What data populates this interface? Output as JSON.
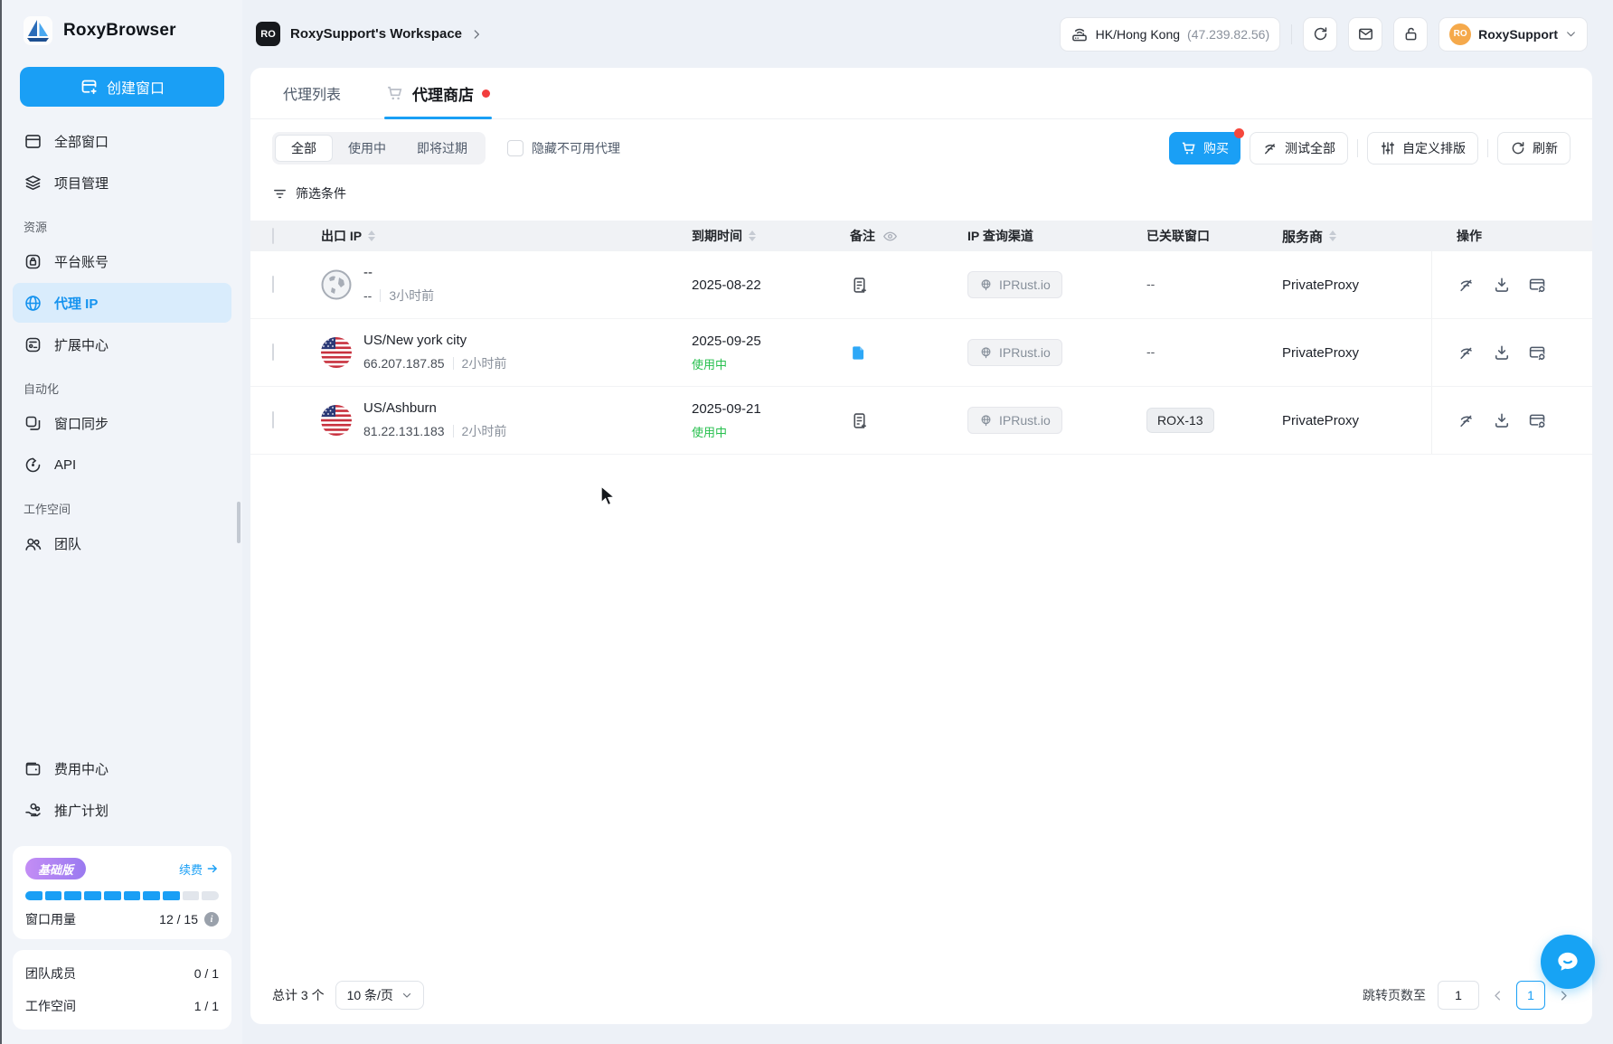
{
  "app": {
    "name": "RoxyBrowser"
  },
  "colors": {
    "accent": "#1a9ff5",
    "green": "#26bf4d",
    "red": "#f5473c",
    "badge_gradient": [
      "#c38df5",
      "#9a7af0"
    ],
    "avatar_orange": "#f5a94b"
  },
  "sidebar": {
    "create_button": "创建窗口",
    "nav": {
      "all_windows": "全部窗口",
      "projects": "项目管理",
      "platform_accounts": "平台账号",
      "proxy_ip": "代理 IP",
      "extensions": "扩展中心",
      "window_sync": "窗口同步",
      "api": "API",
      "team": "团队"
    },
    "sections": {
      "resources": "资源",
      "automation": "自动化",
      "workspace": "工作空间"
    },
    "footer": {
      "billing": "费用中心",
      "promo": "推广计划"
    },
    "plan": {
      "badge": "基础版",
      "renew": "续费",
      "usage_label": "窗口用量",
      "usage_value": "12 / 15",
      "segments_filled": 8,
      "segments_total": 10
    },
    "stats": {
      "team_label": "团队成员",
      "team_value": "0 / 1",
      "workspace_label": "工作空间",
      "workspace_value": "1 / 1"
    }
  },
  "header": {
    "workspace_badge": "RO",
    "workspace_title": "RoxySupport's Workspace",
    "network_location": "HK/Hong Kong",
    "network_ip": "(47.239.82.56)",
    "user_initials": "RO",
    "user_name": "RoxySupport"
  },
  "tabs": {
    "proxy_list": "代理列表",
    "proxy_store": "代理商店"
  },
  "filters": {
    "all": "全部",
    "in_use": "使用中",
    "expiring": "即将过期",
    "hide_unavailable": "隐藏不可用代理",
    "filter_label": "筛选条件"
  },
  "actions": {
    "buy": "购买",
    "test_all": "测试全部",
    "custom_layout": "自定义排版",
    "refresh": "刷新"
  },
  "table": {
    "columns": {
      "export_ip": "出口 IP",
      "expire": "到期时间",
      "note": "备注",
      "query": "IP 查询渠道",
      "linked": "已关联窗口",
      "provider": "服务商",
      "ops": "操作"
    },
    "rows": [
      {
        "location": "--",
        "ip": "--",
        "time": "3小时前",
        "expire": "2025-08-22",
        "status": "",
        "query": "IPRust.io",
        "linked": "--",
        "provider": "PrivateProxy"
      },
      {
        "location": "US/New york city",
        "ip": "66.207.187.85",
        "time": "2小时前",
        "expire": "2025-09-25",
        "status": "使用中",
        "query": "IPRust.io",
        "linked": "--",
        "provider": "PrivateProxy"
      },
      {
        "location": "US/Ashburn",
        "ip": "81.22.131.183",
        "time": "2小时前",
        "expire": "2025-09-21",
        "status": "使用中",
        "query": "IPRust.io",
        "linked": "ROX-13",
        "provider": "PrivateProxy"
      }
    ]
  },
  "pagination": {
    "total": "总计 3 个",
    "page_size": "10 条/页",
    "jump_label": "跳转页数至",
    "jump_value": "1",
    "current_page": "1"
  }
}
